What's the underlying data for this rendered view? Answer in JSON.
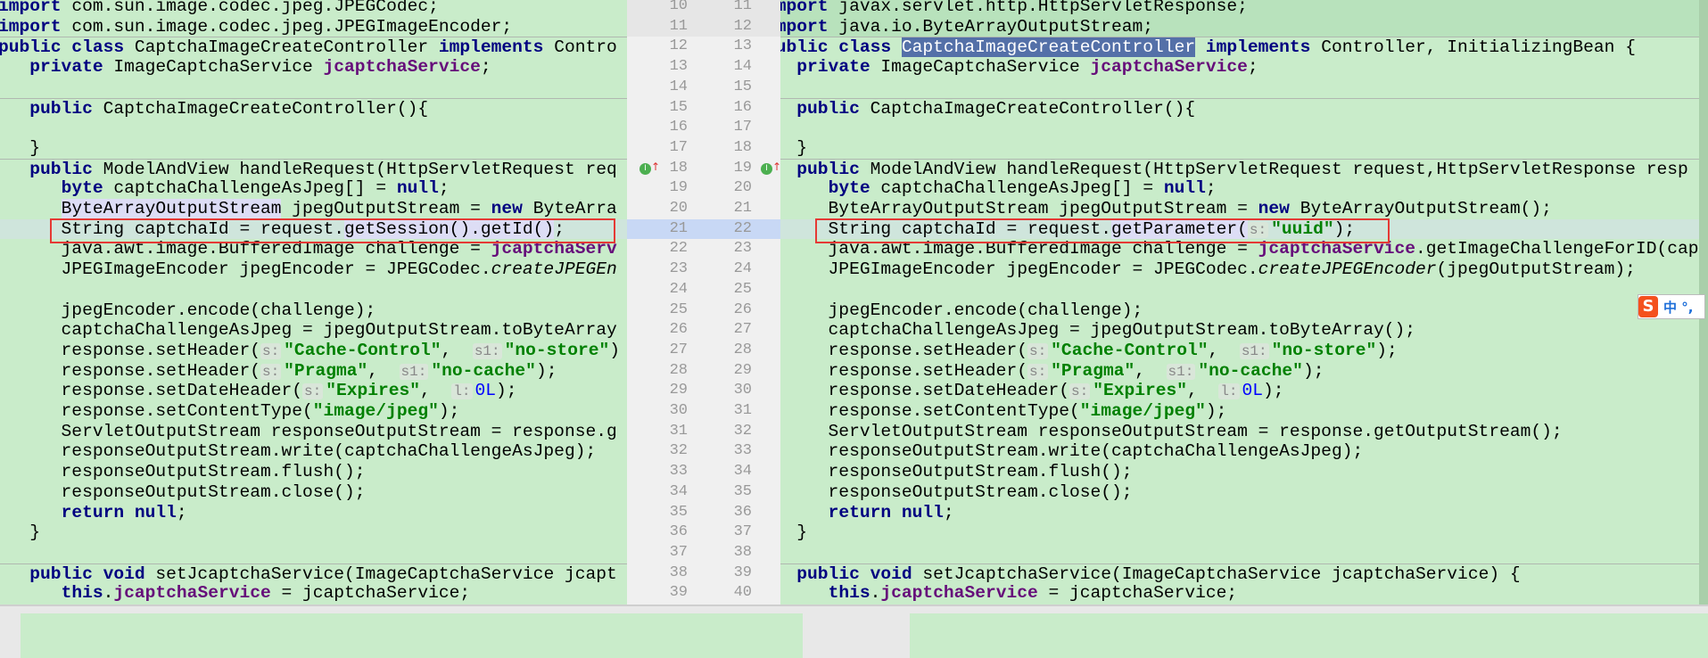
{
  "left_line_numbers": [
    10,
    11,
    12,
    13,
    14,
    15,
    16,
    17,
    18,
    19,
    20,
    21,
    22,
    23,
    24,
    25,
    26,
    27,
    28,
    29,
    30,
    31,
    32,
    33,
    34,
    35,
    36,
    37,
    38,
    39
  ],
  "right_line_numbers": [
    11,
    12,
    13,
    14,
    15,
    16,
    17,
    18,
    19,
    20,
    21,
    22,
    23,
    24,
    25,
    26,
    27,
    28,
    29,
    30,
    31,
    32,
    33,
    34,
    35,
    36,
    37,
    38,
    39,
    40
  ],
  "current_row": 11,
  "changed_rows": [
    0,
    1
  ],
  "separator_rows": [
    2,
    5,
    8,
    28
  ],
  "left_lines": [
    [
      [
        "k",
        "import"
      ],
      [
        "t",
        " com.sun.image.codec.jpeg.JPEGCodec;"
      ]
    ],
    [
      [
        "k",
        "import"
      ],
      [
        "t",
        " com.sun.image.codec.jpeg.JPEGImageEncoder;"
      ]
    ],
    [
      [
        "k",
        "public class "
      ],
      [
        "t",
        "CaptchaImageCreateController "
      ],
      [
        "k",
        "implements "
      ],
      [
        "t",
        "Contro"
      ]
    ],
    [
      [
        "t",
        "   "
      ],
      [
        "k",
        "private "
      ],
      [
        "t",
        "ImageCaptchaService "
      ],
      [
        "f",
        "jcaptchaService"
      ],
      [
        "t",
        ";"
      ]
    ],
    [],
    [
      [
        "t",
        "   "
      ],
      [
        "k",
        "public "
      ],
      [
        "t",
        "CaptchaImageCreateController(){"
      ]
    ],
    [],
    [
      [
        "t",
        "   }"
      ]
    ],
    [
      [
        "t",
        "   "
      ],
      [
        "k",
        "public "
      ],
      [
        "t",
        "ModelAndView handleRequest(HttpServletRequest req"
      ]
    ],
    [
      [
        "t",
        "      "
      ],
      [
        "k",
        "byte "
      ],
      [
        "t",
        "captchaChallengeAsJpeg[] = "
      ],
      [
        "k",
        "null"
      ],
      [
        "t",
        ";"
      ]
    ],
    [
      [
        "t",
        "      "
      ],
      [
        "cls",
        "ByteArrayOutputStream"
      ],
      [
        "t",
        " jpegOutputStream = "
      ],
      [
        "k",
        "new "
      ],
      [
        "t",
        "ByteArra"
      ]
    ],
    [
      [
        "t",
        "      String captchaId = request."
      ],
      [
        "cls",
        "getSession().getId()"
      ],
      [
        "t",
        ";"
      ]
    ],
    [
      [
        "t",
        "      java.awt.image.BufferedImage challenge = "
      ],
      [
        "f",
        "jcaptchaServ"
      ]
    ],
    [
      [
        "t",
        "      JPEGImageEncoder jpegEncoder = JPEGCodec."
      ],
      [
        "i",
        "createJPEGEn"
      ]
    ],
    [],
    [
      [
        "t",
        "      jpegEncoder.encode(challenge);"
      ]
    ],
    [
      [
        "t",
        "      captchaChallengeAsJpeg = jpegOutputStream.toByteArray"
      ]
    ],
    [
      [
        "t",
        "      response.setHeader("
      ],
      [
        "h",
        "s:"
      ],
      [
        "s",
        "\"Cache-Control\""
      ],
      [
        "t",
        ",  "
      ],
      [
        "h",
        "s1:"
      ],
      [
        "s",
        "\"no-store\""
      ],
      [
        "t",
        ")"
      ]
    ],
    [
      [
        "t",
        "      response.setHeader("
      ],
      [
        "h",
        "s:"
      ],
      [
        "s",
        "\"Pragma\""
      ],
      [
        "t",
        ",  "
      ],
      [
        "h",
        "s1:"
      ],
      [
        "s",
        "\"no-cache\""
      ],
      [
        "t",
        ");"
      ]
    ],
    [
      [
        "t",
        "      response.setDateHeader("
      ],
      [
        "h",
        "s:"
      ],
      [
        "s",
        "\"Expires\""
      ],
      [
        "t",
        ",  "
      ],
      [
        "h",
        "l:"
      ],
      [
        "n",
        "0L"
      ],
      [
        "t",
        ");"
      ]
    ],
    [
      [
        "t",
        "      response.setContentType("
      ],
      [
        "s",
        "\"image/jpeg\""
      ],
      [
        "t",
        ");"
      ]
    ],
    [
      [
        "t",
        "      ServletOutputStream responseOutputStream = response.g"
      ]
    ],
    [
      [
        "t",
        "      responseOutputStream.write(captchaChallengeAsJpeg);"
      ]
    ],
    [
      [
        "t",
        "      responseOutputStream.flush();"
      ]
    ],
    [
      [
        "t",
        "      responseOutputStream.close();"
      ]
    ],
    [
      [
        "t",
        "      "
      ],
      [
        "k",
        "return null"
      ],
      [
        "t",
        ";"
      ]
    ],
    [
      [
        "t",
        "   }"
      ]
    ],
    [],
    [
      [
        "t",
        "   "
      ],
      [
        "k",
        "public void "
      ],
      [
        "t",
        "setJcaptchaService(ImageCaptchaService jcapt"
      ]
    ],
    [
      [
        "t",
        "      "
      ],
      [
        "k",
        "this"
      ],
      [
        "t",
        "."
      ],
      [
        "f",
        "jcaptchaService"
      ],
      [
        "t",
        " = jcaptchaService;"
      ]
    ]
  ],
  "right_lines": [
    [
      [
        "k",
        "import"
      ],
      [
        "t",
        " javax.servlet.http.HttpServletResponse;"
      ]
    ],
    [
      [
        "k",
        "import"
      ],
      [
        "t",
        " java.io.ByteArrayOutputStream;"
      ]
    ],
    [
      [
        "k",
        "public class "
      ],
      [
        "sel",
        "CaptchaImageCreateController"
      ],
      [
        "t",
        " "
      ],
      [
        "k",
        "implements "
      ],
      [
        "t",
        "Controller, InitializingBean {"
      ]
    ],
    [
      [
        "t",
        "   "
      ],
      [
        "k",
        "private "
      ],
      [
        "t",
        "ImageCaptchaService "
      ],
      [
        "f",
        "jcaptchaService"
      ],
      [
        "t",
        ";"
      ]
    ],
    [],
    [
      [
        "t",
        "   "
      ],
      [
        "k",
        "public "
      ],
      [
        "t",
        "CaptchaImageCreateController(){"
      ]
    ],
    [],
    [
      [
        "t",
        "   }"
      ]
    ],
    [
      [
        "t",
        "   "
      ],
      [
        "k",
        "public "
      ],
      [
        "t",
        "ModelAndView handleRequest(HttpServletRequest request,HttpServletResponse resp"
      ]
    ],
    [
      [
        "t",
        "      "
      ],
      [
        "k",
        "byte "
      ],
      [
        "t",
        "captchaChallengeAsJpeg[] = "
      ],
      [
        "k",
        "null"
      ],
      [
        "t",
        ";"
      ]
    ],
    [
      [
        "t",
        "      ByteArrayOutputStream jpegOutputStream = "
      ],
      [
        "k",
        "new "
      ],
      [
        "t",
        "ByteArrayOutputStream();"
      ]
    ],
    [
      [
        "t",
        "      String captchaId = request."
      ],
      [
        "cls",
        "getParameter("
      ],
      [
        "h",
        "s:"
      ],
      [
        "s",
        "\"uuid\""
      ],
      [
        "t",
        ");"
      ]
    ],
    [
      [
        "t",
        "      java.awt.image.BufferedImage challenge = "
      ],
      [
        "f",
        "jcaptchaService"
      ],
      [
        "t",
        ".getImageChallengeForID(cap"
      ]
    ],
    [
      [
        "t",
        "      JPEGImageEncoder jpegEncoder = JPEGCodec."
      ],
      [
        "i",
        "createJPEGEncoder"
      ],
      [
        "t",
        "(jpegOutputStream);"
      ]
    ],
    [],
    [
      [
        "t",
        "      jpegEncoder.encode(challenge);"
      ]
    ],
    [
      [
        "t",
        "      captchaChallengeAsJpeg = jpegOutputStream.toByteArray();"
      ]
    ],
    [
      [
        "t",
        "      response.setHeader("
      ],
      [
        "h",
        "s:"
      ],
      [
        "s",
        "\"Cache-Control\""
      ],
      [
        "t",
        ",  "
      ],
      [
        "h",
        "s1:"
      ],
      [
        "s",
        "\"no-store\""
      ],
      [
        "t",
        ");"
      ]
    ],
    [
      [
        "t",
        "      response.setHeader("
      ],
      [
        "h",
        "s:"
      ],
      [
        "s",
        "\"Pragma\""
      ],
      [
        "t",
        ",  "
      ],
      [
        "h",
        "s1:"
      ],
      [
        "s",
        "\"no-cache\""
      ],
      [
        "t",
        ");"
      ]
    ],
    [
      [
        "t",
        "      response.setDateHeader("
      ],
      [
        "h",
        "s:"
      ],
      [
        "s",
        "\"Expires\""
      ],
      [
        "t",
        ",  "
      ],
      [
        "h",
        "l:"
      ],
      [
        "n",
        "0L"
      ],
      [
        "t",
        ");"
      ]
    ],
    [
      [
        "t",
        "      response.setContentType("
      ],
      [
        "s",
        "\"image/jpeg\""
      ],
      [
        "t",
        ");"
      ]
    ],
    [
      [
        "t",
        "      ServletOutputStream responseOutputStream = response.getOutputStream();"
      ]
    ],
    [
      [
        "t",
        "      responseOutputStream.write(captchaChallengeAsJpeg);"
      ]
    ],
    [
      [
        "t",
        "      responseOutputStream.flush();"
      ]
    ],
    [
      [
        "t",
        "      responseOutputStream.close();"
      ]
    ],
    [
      [
        "t",
        "      "
      ],
      [
        "k",
        "return null"
      ],
      [
        "t",
        ";"
      ]
    ],
    [
      [
        "t",
        "   }"
      ]
    ],
    [],
    [
      [
        "t",
        "   "
      ],
      [
        "k",
        "public void "
      ],
      [
        "t",
        "setJcaptchaService(ImageCaptchaService jcaptchaService) {"
      ]
    ],
    [
      [
        "t",
        "      "
      ],
      [
        "k",
        "this"
      ],
      [
        "t",
        "."
      ],
      [
        "f",
        "jcaptchaService"
      ],
      [
        "t",
        " = jcaptchaService;"
      ]
    ]
  ],
  "ime": {
    "logo": "S",
    "text": "中 °,"
  },
  "marker_label": "I",
  "colors": {
    "keyword": "#000080",
    "field": "#660e7a",
    "string": "#008000",
    "highlight_box": "#e53935",
    "background": "#c9ecca"
  }
}
